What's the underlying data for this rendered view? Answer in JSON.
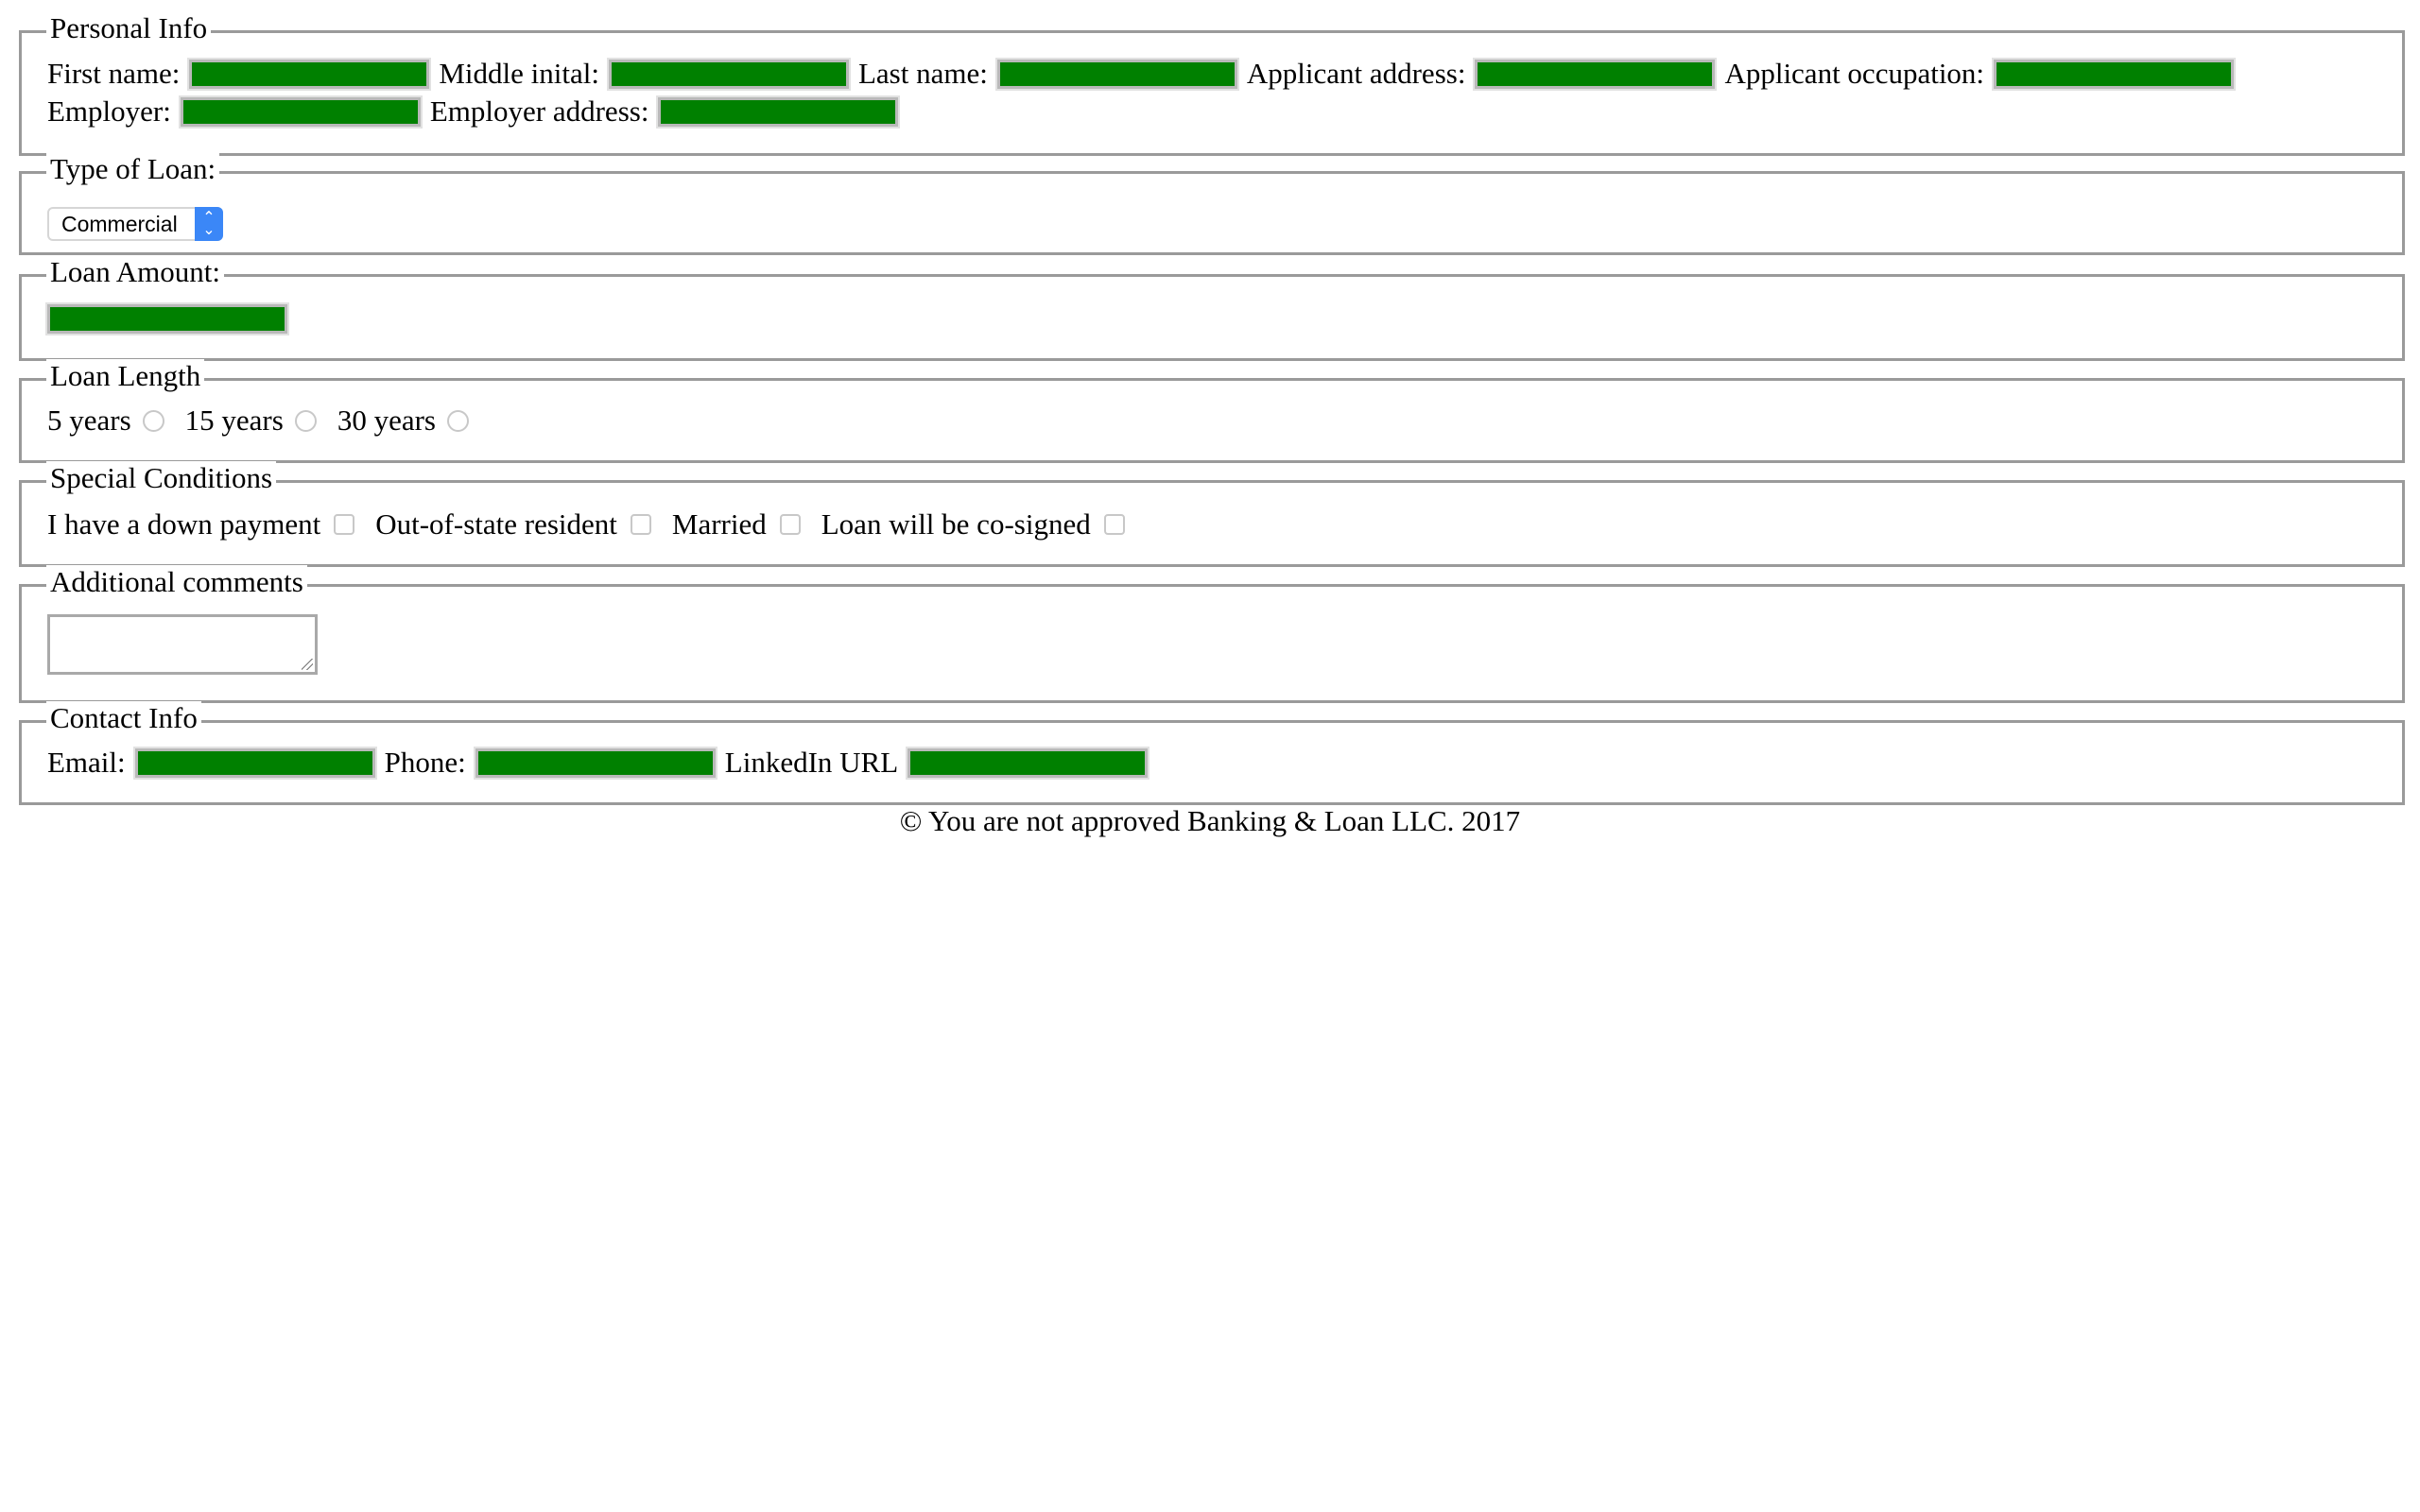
{
  "personal_info": {
    "legend": "Personal Info",
    "first_name_label": "First name:",
    "middle_initial_label": "Middle inital:",
    "last_name_label": "Last name:",
    "applicant_address_label": "Applicant address:",
    "applicant_occupation_label": "Applicant occupation:",
    "employer_label": "Employer:",
    "employer_address_label": "Employer address:",
    "field_color": "#008000"
  },
  "loan_type": {
    "legend": "Type of Loan:",
    "selected": "Commercial",
    "select_accent_color": "#3b87f7"
  },
  "loan_amount": {
    "legend": "Loan Amount:"
  },
  "loan_length": {
    "legend": "Loan Length",
    "options": [
      "5 years",
      "15 years",
      "30 years"
    ]
  },
  "special_conditions": {
    "legend": "Special Conditions",
    "options": [
      "I have a down payment",
      "Out-of-state resident",
      "Married",
      "Loan will be co-signed"
    ]
  },
  "additional_comments": {
    "legend": "Additional comments"
  },
  "contact_info": {
    "legend": "Contact Info",
    "email_label": "Email:",
    "phone_label": "Phone:",
    "linkedin_label": "LinkedIn URL"
  },
  "footer": {
    "text": "© You are not approved Banking & Loan LLC. 2017"
  }
}
